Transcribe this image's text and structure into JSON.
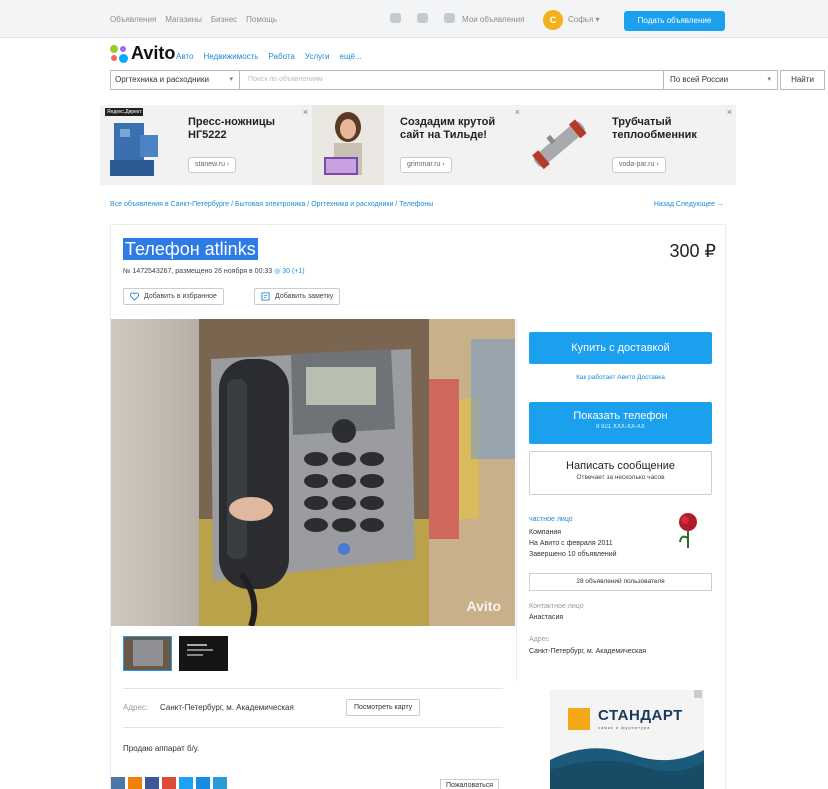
{
  "topbar": {
    "nav": [
      "Объявления",
      "Магазины",
      "Бизнес",
      "Помощь"
    ],
    "my_ads": "Мои объявления",
    "avatar_letter": "С",
    "username": "Софья",
    "post_button": "Подать объявление"
  },
  "logo": {
    "text": "Avito"
  },
  "categories": [
    "Авто",
    "Недвижимость",
    "Работа",
    "Услуги",
    "ещё..."
  ],
  "search": {
    "category": "Оргтехника и расходники",
    "placeholder": "Поиск по объявлениям",
    "region": "По всей России",
    "button": "Найти"
  },
  "ads": [
    {
      "title": "Пресс-ножницы НГ5222",
      "link": "stanew.ru ›",
      "label": "Яндекс.Директ"
    },
    {
      "title": "Создадим крутой сайт на Тильде!",
      "link": "grimmar.ru ›"
    },
    {
      "title": "Трубчатый теплообменник",
      "link": "voda-par.ru ›"
    }
  ],
  "breadcrumb": "Все объявления в Санкт-Петербурге / Бытовая электроника / Оргтехника и расходники / Телефоны",
  "prevnext": "Назад   Следующее →",
  "item": {
    "title": "Телефон atlinks",
    "price": "300 ₽",
    "meta": "№ 1472543267, размещено 26 ноября в 00:33",
    "views": "30 (+1)",
    "fav_button": "Добавить в избранное",
    "note_button": "Добавить заметку",
    "watermark": "Avito",
    "address_label": "Адрес:",
    "address": "Санкт-Петербург, м. Академическая",
    "map_button": "Посмотреть карту",
    "description": "Продаю аппарат б/у.",
    "complain_button": "Пожаловаться"
  },
  "sidebar": {
    "buy_button": "Купить с доставкой",
    "delivery_link": "Как работает Авито Доставка",
    "phone_button": "Показать телефон",
    "phone_masked": "8 921 XXX-XX-XX",
    "message_button": "Написать сообщение",
    "message_sub": "Отвечает за несколько часов",
    "seller_type": "частное лицо",
    "seller_info": [
      "Компания",
      "На Авито с февраля 2011",
      "Завершено 10 объявлений"
    ],
    "user_ads_button": "28 объявлений пользователя",
    "contact_label": "Контактное лицо",
    "contact_name": "Анастасия",
    "address_label": "Адрес",
    "address": "Санкт-Петербург, м. Академическая"
  },
  "banner": {
    "title": "СТАНДАРТ",
    "subtitle": "замки и фурнитура"
  },
  "colors": {
    "accent": "#1ba0ed",
    "link": "#1e8bd8",
    "brand_orange": "#f4a818"
  }
}
